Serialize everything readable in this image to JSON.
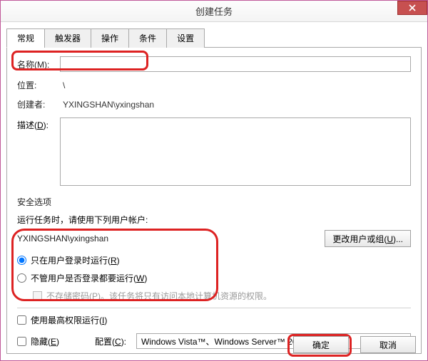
{
  "window": {
    "title": "创建任务"
  },
  "tabs": [
    "常规",
    "触发器",
    "操作",
    "条件",
    "设置"
  ],
  "active_tab": 0,
  "labels": {
    "name": "名称(M):",
    "location": "位置:",
    "creator": "创建者:",
    "description": "描述(D):",
    "security": "安全选项",
    "security_line": "运行任务时，请使用下列用户帐户:",
    "change_user": "更改用户或组(U)...",
    "radio_logged": "只在用户登录时运行(R)",
    "radio_always": "不管用户是否登录都要运行(W)",
    "store_pwd": "不存储密码(P)。该任务将只有访问本地计算机资源的权限。",
    "highest_priv": "使用最高权限运行(I)",
    "hidden": "隐藏(E)",
    "configure": "配置(C):",
    "ok": "确定",
    "cancel": "取消"
  },
  "values": {
    "name": "",
    "location": "\\",
    "creator": "YXINGSHAN\\yxingshan",
    "description": "",
    "account": "YXINGSHAN\\yxingshan",
    "run_mode": "logged",
    "store_pwd": false,
    "highest_priv": false,
    "hidden": false,
    "configure": "Windows Vista™、Windows Server™ 2008"
  }
}
